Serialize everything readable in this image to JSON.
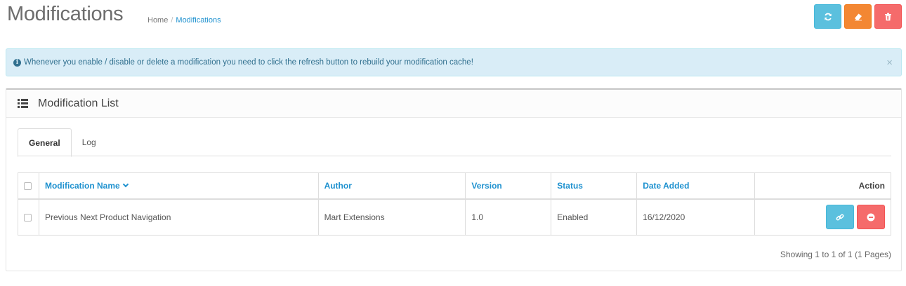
{
  "header": {
    "title": "Modifications",
    "breadcrumb": {
      "home": "Home",
      "separator": "/",
      "current": "Modifications"
    }
  },
  "toolbar": {
    "refresh_icon": "refresh-icon",
    "clear_icon": "eraser-icon",
    "delete_icon": "trash-icon"
  },
  "alert": {
    "icon": "info-circle-icon",
    "text": "Whenever you enable / disable or delete a modification you need to click the refresh button to rebuild your modification cache!",
    "close": "×"
  },
  "panel": {
    "title": "Modification List",
    "tabs": [
      {
        "label": "General",
        "active": true
      },
      {
        "label": "Log",
        "active": false
      }
    ],
    "table": {
      "columns": {
        "name": "Modification Name",
        "author": "Author",
        "version": "Version",
        "status": "Status",
        "date_added": "Date Added",
        "action": "Action"
      },
      "rows": [
        {
          "name": "Previous Next Product Navigation",
          "author": "Mart Extensions",
          "version": "1.0",
          "status": "Enabled",
          "date_added": "16/12/2020"
        }
      ]
    },
    "pagination": "Showing 1 to 1 of 1 (1 Pages)"
  },
  "colors": {
    "info": "#5bc0de",
    "warning": "#f38733",
    "danger": "#f56b6b",
    "link": "#1e91cf",
    "alert_bg": "#d9edf7"
  }
}
